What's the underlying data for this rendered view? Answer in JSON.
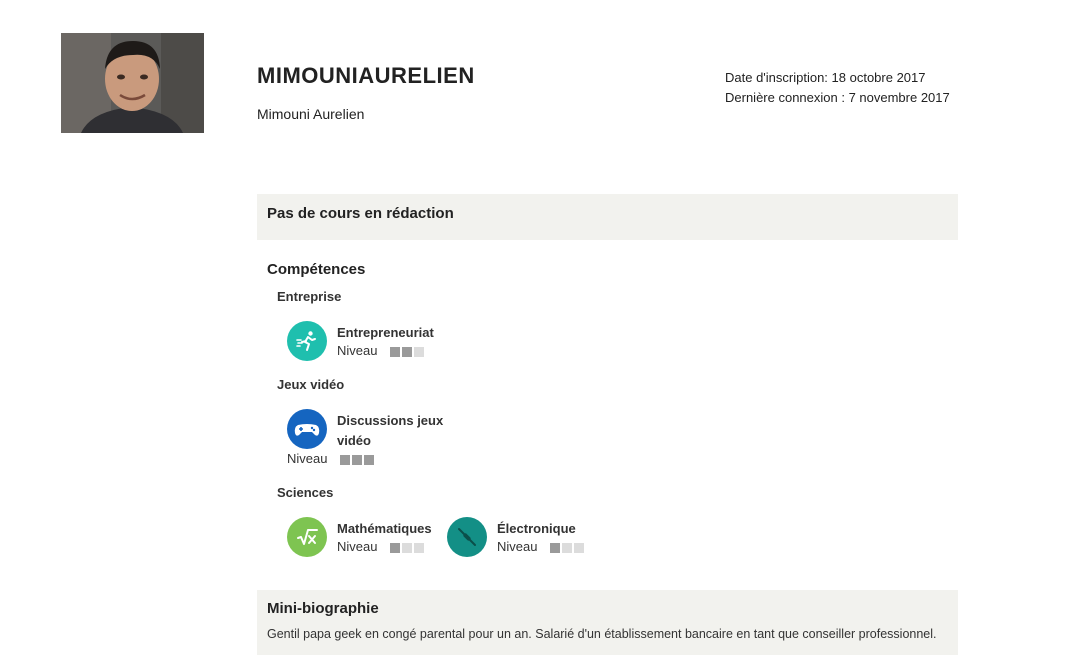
{
  "profile": {
    "username": "MIMOUNIAURELIEN",
    "full_name": "Mimouni Aurelien",
    "signup_date": "Date d'inscription: 18 octobre 2017",
    "last_login": "Dernière connexion : 7 novembre 2017"
  },
  "drafts": {
    "title": "Pas de cours en rédaction"
  },
  "skills": {
    "title": "Compétences",
    "categories": [
      {
        "name": "Entreprise",
        "items": [
          {
            "name": "Entrepreneuriat",
            "level_label": "Niveau",
            "level": 2,
            "max": 3,
            "icon": "runner-icon",
            "color": "#1fbfae"
          }
        ]
      },
      {
        "name": "Jeux vidéo",
        "items": [
          {
            "name": "Discussions jeux vidéo",
            "level_label": "Niveau",
            "level": 3,
            "max": 3,
            "icon": "gamepad-icon",
            "color": "#1565c0"
          }
        ]
      },
      {
        "name": "Sciences",
        "items": [
          {
            "name": "Mathématiques",
            "level_label": "Niveau",
            "level": 1,
            "max": 3,
            "icon": "square-root-icon",
            "color": "#7ec451"
          },
          {
            "name": "Électronique",
            "level_label": "Niveau",
            "level": 1,
            "max": 3,
            "icon": "resistor-icon",
            "color": "#138f86"
          }
        ]
      }
    ]
  },
  "bio": {
    "title": "Mini-biographie",
    "text": "Gentil papa geek en congé parental pour un an. Salarié d'un établissement bancaire en tant que conseiller professionnel."
  }
}
